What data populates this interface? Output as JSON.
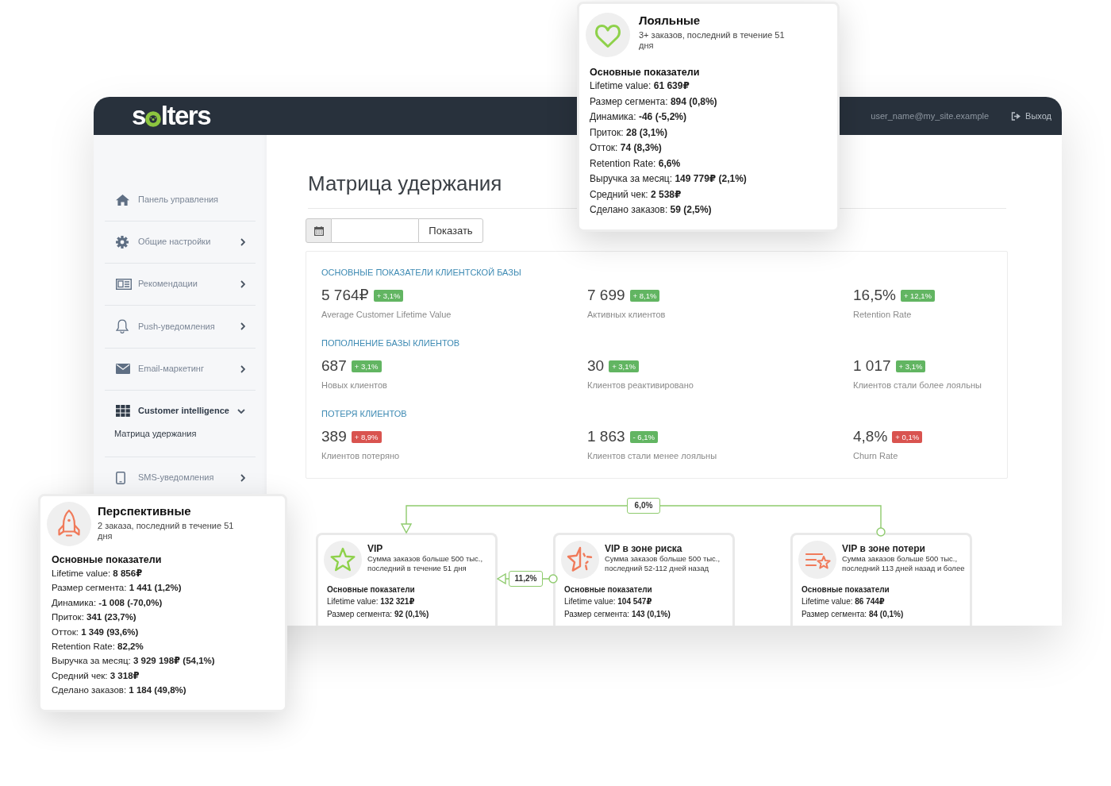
{
  "header": {
    "logo": {
      "start": "s",
      "end": "lters"
    },
    "user": "user_name@my_site.example",
    "logout": "Выход"
  },
  "sidebar": {
    "items": [
      {
        "label": "Панель управления",
        "kind": "link",
        "selected": false
      },
      {
        "label": "Общие настройки",
        "kind": "group",
        "expanded": false,
        "selected": false
      },
      {
        "label": "Рекомендации",
        "kind": "group",
        "expanded": false,
        "selected": false
      },
      {
        "label": "Push-уведомления",
        "kind": "group",
        "expanded": false,
        "selected": false
      },
      {
        "label": "Email-маркетинг",
        "kind": "group",
        "expanded": false,
        "selected": false
      },
      {
        "label": "Customer intelligence",
        "kind": "group",
        "expanded": true,
        "selected": true,
        "children": [
          {
            "label": "Матрица удержания",
            "selected": true
          }
        ]
      },
      {
        "label": "SMS-уведомления",
        "kind": "group",
        "expanded": false,
        "selected": false
      }
    ]
  },
  "title": "Матрица удержания",
  "filter": {
    "button": "Показать"
  },
  "metrics": [
    {
      "title": "ОСНОВНЫЕ ПОКАЗАТЕЛИ КЛИЕНТСКОЙ БАЗЫ",
      "items": [
        {
          "value": "5 764₽",
          "change": "+ 3,1%",
          "color": "#62b562",
          "label": "Average Customer Lifetime Value"
        },
        {
          "value": "7 699",
          "change": "+ 8,1%",
          "color": "#62b562",
          "label": "Активных клиентов"
        },
        {
          "value": "16,5%",
          "change": "+ 12,1%",
          "color": "#62b562",
          "label": "Retention Rate"
        }
      ]
    },
    {
      "title": "ПОПОЛНЕНИЕ БАЗЫ КЛИЕНТОВ",
      "items": [
        {
          "value": "687",
          "change": "+ 3,1%",
          "color": "#62b562",
          "label": "Новых клиентов"
        },
        {
          "value": "30",
          "change": "+ 3,1%",
          "color": "#62b562",
          "label": "Клиентов реактивировано"
        },
        {
          "value": "1 017",
          "change": "+ 3,1%",
          "color": "#62b562",
          "label": "Клиентов стали более лояльны"
        }
      ]
    },
    {
      "title": "ПОТЕРЯ КЛИЕНТОВ",
      "items": [
        {
          "value": "389",
          "change": "+ 8,9%",
          "color": "#d9534f",
          "label": "Клиентов потеряно"
        },
        {
          "value": "1 863",
          "change": "- 6,1%",
          "color": "#62b562",
          "label": "Клиентов стали менее лояльны"
        },
        {
          "value": "4,8%",
          "change": "+ 0,1%",
          "color": "#d9534f",
          "label": "Churn Rate"
        }
      ]
    }
  ],
  "segments": [
    {
      "title": "VIP",
      "description": "Сумма заказов больше 500 тыс., последний в течение 51 дня",
      "heading": "Основные показатели",
      "rows": [
        "Lifetime value: **132 321₽**",
        "Размер сегмента: **92 (0,1%)**"
      ]
    },
    {
      "title": "VIP в зоне риска",
      "description": "Сумма заказов больше 500 тыс., последний 52-112 дней назад",
      "heading": "Основные показатели",
      "rows": [
        "Lifetime value: **104 547₽**",
        "Размер сегмента: **143 (0,1%)**"
      ]
    },
    {
      "title": "VIP в зоне потери",
      "description": "Сумма заказов больше 500 тыс., последний 113 дней назад и более",
      "heading": "Основные показатели",
      "rows": [
        "Lifetime value: **86 744₽**",
        "Размер сегмента: **84 (0,1%)**"
      ]
    }
  ],
  "connectors": [
    {
      "label": "6,0%"
    },
    {
      "label": "11,2%"
    }
  ],
  "popups": [
    {
      "title": "Лояльные",
      "description": "3+ заказов, последний в течение 51 дня",
      "heading": "Основные показатели",
      "rows": [
        "Lifetime value: **61 639₽**",
        "Размер сегмента: **894 (0,8%)**",
        "Динамика: **-46 (-5,2%)**",
        "Приток: **28 (3,1%)**",
        "Отток: **74 (8,3%)**",
        "Retention Rate: **6,6%**",
        "Выручка за месяц: **149 779₽ (2,1%)**",
        "Средний чек: **2 538₽**",
        "Сделано заказов: **59 (2,5%)**"
      ]
    },
    {
      "title": "Перспективные",
      "description": "2 заказа, последний в течение 51 дня",
      "heading": "Основные показатели",
      "rows": [
        "Lifetime value: **8 856₽**",
        "Размер сегмента: **1 441 (1,2%)**",
        "Динамика: **-1 008 (-70,0%)**",
        "Приток: **341 (23,7%)**",
        "Отток: **1 349 (93,6%)**",
        "Retention Rate: **82,2%**",
        "Выручка за месяц: **3 929 198₽ (54,1%)**",
        "Средний чек: **3 318₽**",
        "Сделано заказов: **1 184 (49,8%)**"
      ]
    }
  ]
}
